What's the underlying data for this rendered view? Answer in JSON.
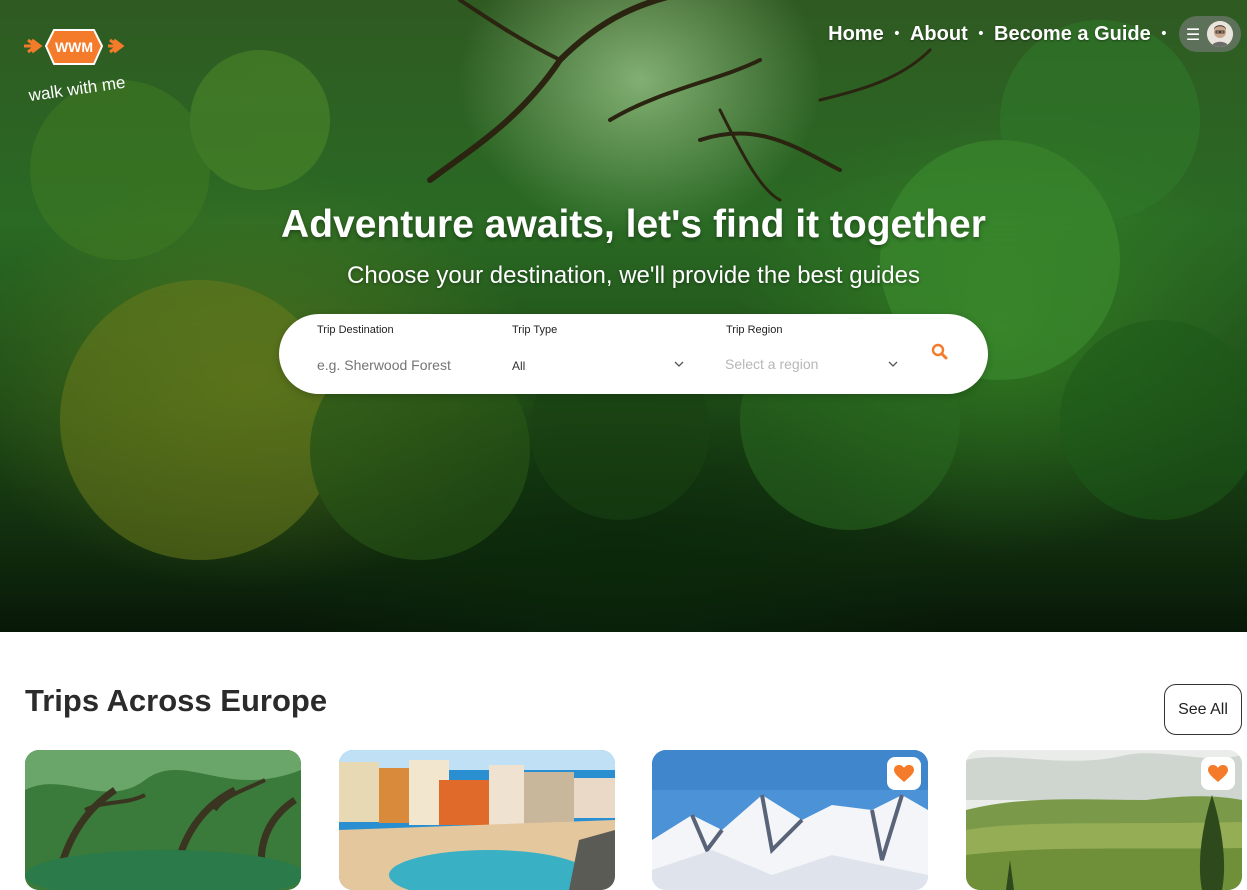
{
  "brand": {
    "logo_mark": "WWM",
    "logo_tagline": "walk with me"
  },
  "nav": {
    "links": [
      "Home",
      "About",
      "Become a Guide"
    ],
    "separator": "•",
    "menu_icon": "hamburger-icon",
    "avatar_icon": "user-avatar"
  },
  "hero": {
    "title": "Adventure awaits, let's find it together",
    "subtitle": "Choose your destination, we'll provide the best guides"
  },
  "search": {
    "destination": {
      "label": "Trip Destination",
      "placeholder": "e.g. Sherwood Forest",
      "value": ""
    },
    "trip_type": {
      "label": "Trip Type",
      "value": "All"
    },
    "region": {
      "label": "Trip Region",
      "placeholder": "Select a region"
    },
    "button_icon": "search-icon"
  },
  "trips": {
    "title": "Trips Across Europe",
    "see_all": "See All",
    "cards": [
      {
        "scene": "mossy-forest",
        "favorite": false
      },
      {
        "scene": "coastal-town",
        "favorite": false
      },
      {
        "scene": "snowy-mountains",
        "favorite": true
      },
      {
        "scene": "vineyard-hills",
        "favorite": true
      }
    ]
  },
  "colors": {
    "accent": "#f47b2a",
    "text_dark": "#2b2b2b"
  }
}
